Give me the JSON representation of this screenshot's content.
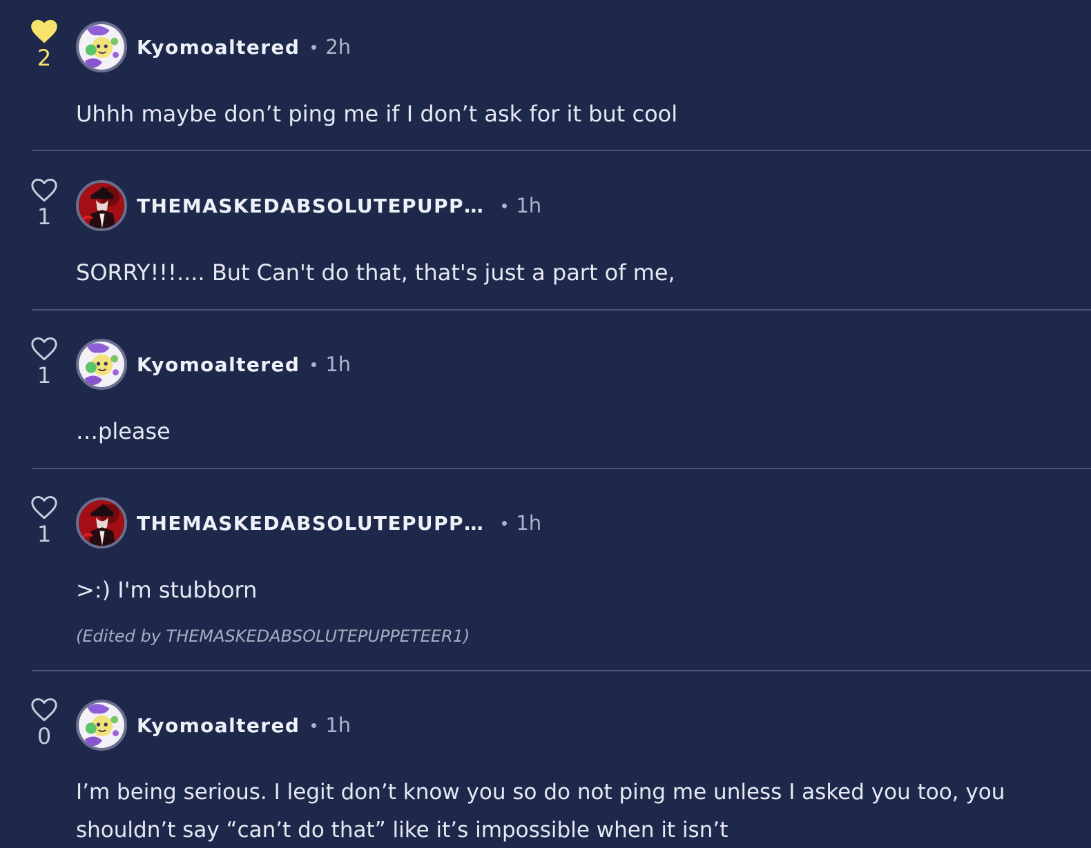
{
  "colors": {
    "background": "#1e284a",
    "liked_heart": "#f7e36c",
    "text": "#e6e9f3",
    "muted": "#aeb5c8",
    "divider": "#4d5675"
  },
  "comments": [
    {
      "like_icon": "heart-filled-icon",
      "likes": "2",
      "liked": true,
      "avatar": "kyomoaltered-avatar",
      "username": "Kyomoaltered",
      "time": "2h",
      "text": "Uhhh maybe don’t ping me if I don’t ask for it but cool"
    },
    {
      "like_icon": "heart-outline-icon",
      "likes": "1",
      "liked": false,
      "avatar": "puppeteer-avatar",
      "username": "THEMASKEDABSOLUTEPUPP…",
      "time": "1h",
      "text": "SORRY!!!.... But Can't do that, that's just a part of me,"
    },
    {
      "like_icon": "heart-outline-icon",
      "likes": "1",
      "liked": false,
      "avatar": "kyomoaltered-avatar",
      "username": "Kyomoaltered",
      "time": "1h",
      "text": "…please"
    },
    {
      "like_icon": "heart-outline-icon",
      "likes": "1",
      "liked": false,
      "avatar": "puppeteer-avatar",
      "username": "THEMASKEDABSOLUTEPUPP…",
      "time": "1h",
      "text": ">:) I'm stubborn",
      "edited": "(Edited by THEMASKEDABSOLUTEPUPPETEER1)"
    },
    {
      "like_icon": "heart-outline-icon",
      "likes": "0",
      "liked": false,
      "avatar": "kyomoaltered-avatar",
      "username": "Kyomoaltered",
      "time": "1h",
      "text": "I’m being serious. I legit don’t know you so do not ping me unless I asked you too, you shouldn’t say “can’t do that” like it’s impossible when it isn’t"
    }
  ]
}
